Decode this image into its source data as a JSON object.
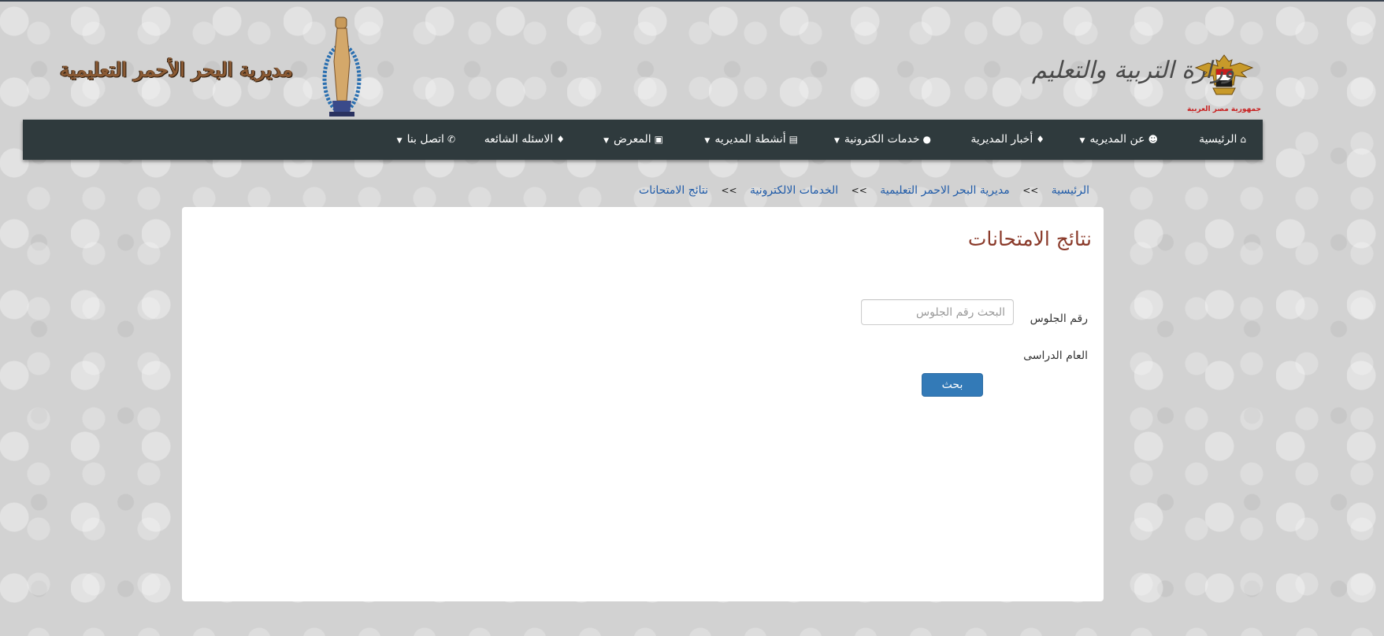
{
  "header": {
    "emblem_caption": "جمهورية مصر العربية",
    "ministry_name": "وزارة التربية والتعليم",
    "directorate_name": "مديرية البحر الأحمر التعليمية"
  },
  "nav": {
    "items": [
      {
        "label": "الرئيسية",
        "icon": "home-icon",
        "dropdown": false
      },
      {
        "label": "عن المديريه",
        "icon": "users-icon",
        "dropdown": true
      },
      {
        "label": "أخبار المديرية",
        "icon": "graduation-cap-icon",
        "dropdown": false
      },
      {
        "label": "خدمات الكترونية",
        "icon": "globe-icon",
        "dropdown": true
      },
      {
        "label": "أنشطة المديريه",
        "icon": "institution-icon",
        "dropdown": true
      },
      {
        "label": "المعرض",
        "icon": "camera-icon",
        "dropdown": true
      },
      {
        "label": "الاسئله الشائعه",
        "icon": "graduation-cap-icon",
        "dropdown": false
      },
      {
        "label": "اتصل بنا",
        "icon": "phone-icon",
        "dropdown": true
      }
    ]
  },
  "breadcrumb": {
    "items": [
      "الرئيسية",
      "مديرية البحر الاحمر التعليمية",
      "الخدمات الالكترونية",
      "نتائج الامتحانات"
    ],
    "separator": ">>"
  },
  "form": {
    "title": "نتائج الامتحانات",
    "seat_label": "رقم الجلوس",
    "seat_placeholder": "البحث رقم الجلوس",
    "seat_value": "",
    "year_label": "العام الدراسى",
    "search_button": "بحث"
  },
  "colors": {
    "navbar_bg": "#2f3a3d",
    "link": "#1e5aa8",
    "title": "#8a3a2a",
    "button": "#337ab7"
  }
}
